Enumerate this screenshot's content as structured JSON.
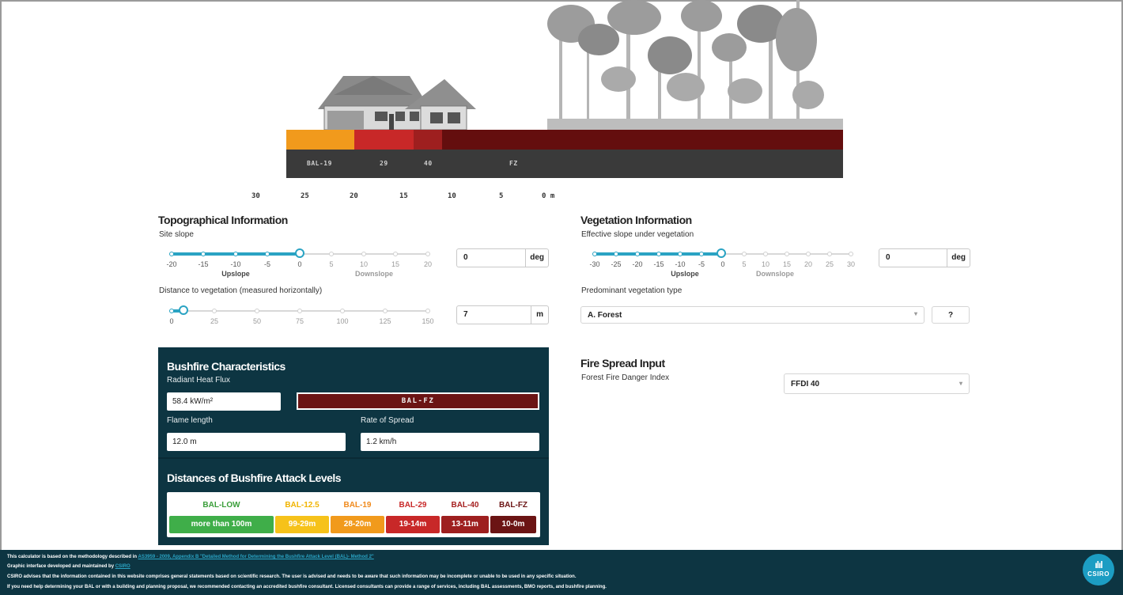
{
  "diagram": {
    "bar_labels": [
      "BAL-19",
      "29",
      "40",
      "FZ"
    ],
    "distance_axis": [
      "30",
      "25",
      "20",
      "15",
      "10",
      "5",
      "0 m"
    ],
    "bar_colors": [
      "#f19a1c",
      "#c82828",
      "#9e1f1f",
      "#640e0e"
    ]
  },
  "topo": {
    "title": "Topographical Information",
    "site_slope_label": "Site slope",
    "site_slope_ticks": [
      "-20",
      "-15",
      "-10",
      "-5",
      "0",
      "5",
      "10",
      "15",
      "20"
    ],
    "upslope": "Upslope",
    "downslope": "Downslope",
    "site_slope_value": "0",
    "site_slope_unit": "deg",
    "distance_label": "Distance to vegetation (measured horizontally)",
    "distance_ticks": [
      "0",
      "25",
      "50",
      "75",
      "100",
      "125",
      "150"
    ],
    "distance_value": "7",
    "distance_unit": "m"
  },
  "veg": {
    "title": "Vegetation Information",
    "slope_label": "Effective slope under vegetation",
    "slope_ticks": [
      "-30",
      "-25",
      "-20",
      "-15",
      "-10",
      "-5",
      "0",
      "5",
      "10",
      "15",
      "20",
      "25",
      "30"
    ],
    "upslope": "Upslope",
    "downslope": "Downslope",
    "slope_value": "0",
    "slope_unit": "deg",
    "type_label": "Predominant vegetation type",
    "type_value": "A. Forest",
    "help_label": "?"
  },
  "fire": {
    "title": "Fire Spread Input",
    "ffdi_label": "Forest Fire Danger Index",
    "ffdi_value": "FFDI 40"
  },
  "bushfire": {
    "title": "Bushfire Characteristics",
    "rhf_label": "Radiant Heat Flux",
    "rhf_value": "58.4 kW/m²",
    "bal_value": "BAL-FZ",
    "flame_label": "Flame length",
    "flame_value": "12.0 m",
    "ros_label": "Rate of Spread",
    "ros_value": "1.2 km/h"
  },
  "distances": {
    "title": "Distances of Bushfire Attack Levels",
    "headers": [
      "BAL-LOW",
      "BAL-12.5",
      "BAL-19",
      "BAL-29",
      "BAL-40",
      "BAL-FZ"
    ],
    "values": [
      "more than 100m",
      "99-29m",
      "28-20m",
      "19-14m",
      "13-11m",
      "10-0m"
    ],
    "header_colors": [
      "#3a9e3a",
      "#f1b400",
      "#f08a1c",
      "#c82828",
      "#a51f1f",
      "#6b1414"
    ],
    "cell_colors": [
      "#3fae49",
      "#f6c21a",
      "#f19a1c",
      "#c82828",
      "#9e1f1f",
      "#6b1414"
    ]
  },
  "footer": {
    "line1_pre": "This calculator is based on the methodology described in ",
    "line1_link": "AS3959 - 2009, Appendix B \"Detailed Method for Determining the Bushfire Attack Level (BAL)- Method 2\"",
    "line2_pre": "Graphic interface developed and maintained by ",
    "line2_link": "CSIRO",
    "line3": "CSIRO advises that the information contained in this website comprises general statements based on scientific research. The user is advised and needs to be aware that such information may be incomplete or unable to be used in any specific situation.",
    "line4": "If you need help determining your BAL or with a building and planning proposal, we recommended contacting an accredited bushfire consultant. Licensed consultants can provide a range of services, including BAL assessments, BMO reports, and bushfire planning.",
    "logo_text": "CSIRO"
  }
}
